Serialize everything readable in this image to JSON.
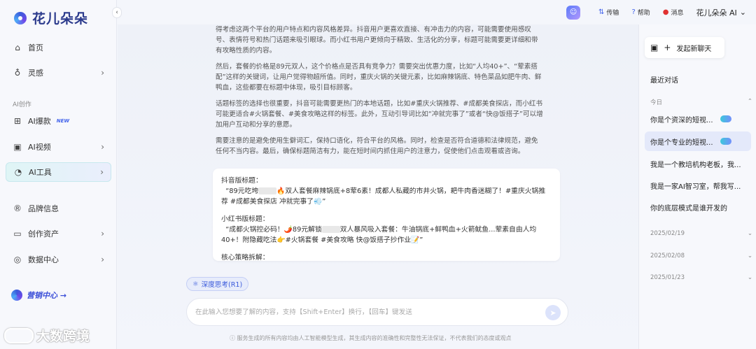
{
  "brand": {
    "name": "花儿朵朵"
  },
  "sidebar": {
    "items": [
      {
        "label": "首页",
        "icon": "home-icon"
      },
      {
        "label": "灵感",
        "icon": "lightbulb-icon"
      },
      {
        "label": "AI爆款",
        "icon": "hot-icon",
        "badge": "NEW"
      },
      {
        "label": "AI视频",
        "icon": "video-icon"
      },
      {
        "label": "AI工具",
        "icon": "tool-icon"
      },
      {
        "label": "品牌信息",
        "icon": "brand-icon"
      },
      {
        "label": "创作资产",
        "icon": "folder-icon"
      },
      {
        "label": "数据中心",
        "icon": "data-icon"
      }
    ],
    "section_label": "AI创作",
    "marketing_label": "营销中心 →"
  },
  "watermark": {
    "text": "大数跨境"
  },
  "topbar": {
    "transfer_label": "传输",
    "help_label": "帮助",
    "messages_label": "消息",
    "user_label": "花儿朵朵 AI"
  },
  "chat": {
    "reasoning": [
      "得考虑这两个平台的用户特点和内容风格差异。抖音用户更喜欢直接、有冲击力的内容，可能需要使用感叹号、表情符号和热门话题来吸引眼球。而小红书用户更倾向于精致、生活化的分享，标题可能需要更详细和带有攻略性质的内容。",
      "然后，套餐的价格是89元双人，这个价格点是否具有竞争力？需要突出优惠力度，比如“人均40+”、“荤素搭配”这样的关键词，让用户觉得物超所值。同时，重庆火锅的关键元素，比如麻辣锅底、特色菜品如肥牛肉、鲜鸭血，这些都要在标题中体现，吸引目标顾客。",
      "话题标签的选择也很重要，抖音可能需要更热门的本地话题，比如#重庆火锅推荐、#成都美食探店，而小红书可能更适合#火锅套餐、#美食攻略这样的标签。此外，互动引导词比如“冲就完事了”或者“快@饭搭子”可以增加用户互动和分享的意愿。",
      "需要注意的是避免使用生僻词汇，保持口语化，符合平台的风格。同时，检查是否符合道德和法律规范，避免任何不当内容。最后，确保标题简洁有力，能在短时间内抓住用户的注意力，促使他们点击观看或咨询。"
    ],
    "answer": {
      "douyin_heading": "抖音版标题：",
      "douyin_a": "“89元吃垮",
      "douyin_b": "🔥双人套餐麻辣锅底+8荤6素！成都人私藏的市井火锅，耙牛肉香迷糊了！#重庆火锅推荐 #成都美食探店 冲就完事了💨”",
      "xhs_heading": "小红书版标题：",
      "xhs_a": "“成都火锅控必码！🌶️89元解锁",
      "xhs_b": "双人暴风吸入套餐：牛油锅底+鲜鸭血+火箭鱿鱼...荤素自由人均40+！附隐藏吃法👉#火锅套餐 #美食攻略 快@饭搭子抄作业📝”",
      "strategy_heading": "核心策略拆解："
    },
    "deep_think_label": "深度思考(R1)",
    "input_placeholder": "在此输入您想要了解的内容，支持【Shift+Enter】换行，【回车】键发送",
    "disclaimer": "ⓘ 服务生成的所有内容均由人工智能模型生成，其生成内容的准确性和完整性无法保证，不代表我们的态度或观点"
  },
  "right": {
    "new_chat_label": "发起新聊天",
    "recent_title": "最近对话",
    "groups": [
      {
        "label": "今日",
        "expanded": true
      },
      {
        "label": "2025/02/19",
        "expanded": false
      },
      {
        "label": "2025/02/08",
        "expanded": false
      },
      {
        "label": "2025/01/23",
        "expanded": false
      }
    ],
    "conversations": [
      "你是个资深的短视...",
      "你是个专业的短视...",
      "我是一个教培机构老板，我...",
      "我是一家AI智习室，帮我写...",
      "你的底层模式是谁开发的"
    ]
  }
}
